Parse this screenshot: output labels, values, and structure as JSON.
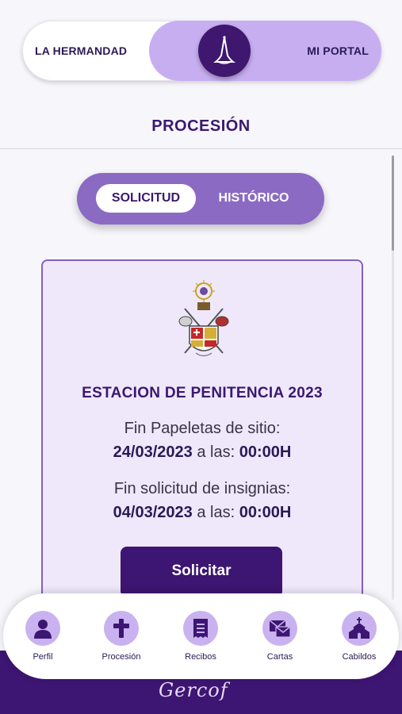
{
  "top_toggle": {
    "left_label": "LA HERMANDAD",
    "right_label": "MI PORTAL"
  },
  "page": {
    "title": "PROCESIÓN"
  },
  "tabs": [
    {
      "label": "SOLICITUD",
      "active": true
    },
    {
      "label": "HISTÓRICO",
      "active": false
    }
  ],
  "card": {
    "title": "ESTACION DE PENITENCIA 2023",
    "items": [
      {
        "label": "Fin Papeletas de sitio:",
        "date": "24/03/2023",
        "sep": "a las:",
        "time": "00:00H"
      },
      {
        "label": "Fin solicitud de insignias:",
        "date": "04/03/2023",
        "sep": "a las:",
        "time": "00:00H"
      }
    ],
    "button_label": "Solicitar"
  },
  "nav": [
    {
      "label": "Perfil",
      "icon": "person-icon"
    },
    {
      "label": "Procesión",
      "icon": "cross-icon"
    },
    {
      "label": "Recibos",
      "icon": "receipt-icon"
    },
    {
      "label": "Cartas",
      "icon": "mail-icon"
    },
    {
      "label": "Cabildos",
      "icon": "chapel-icon"
    }
  ],
  "footer": {
    "logo_text": "Gercof"
  },
  "colors": {
    "primary": "#3d1572",
    "accent": "#c9b2ef",
    "segment": "#8b6ac4",
    "card_bg": "#efe8fb"
  }
}
